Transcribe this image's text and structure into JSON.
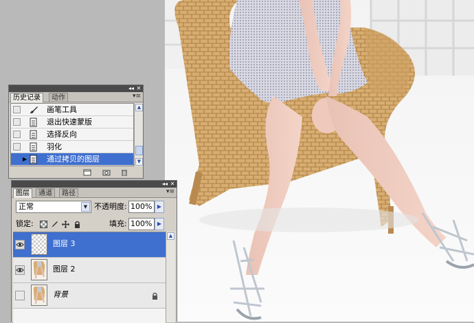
{
  "history_panel": {
    "tabs": [
      "历史记录",
      "动作"
    ],
    "items": [
      {
        "label": "画笔工具",
        "icon": "brush-icon"
      },
      {
        "label": "退出快速蒙版",
        "icon": "history-state-icon"
      },
      {
        "label": "选择反向",
        "icon": "history-state-icon"
      },
      {
        "label": "羽化",
        "icon": "history-state-icon"
      },
      {
        "label": "通过拷贝的图层",
        "icon": "history-state-icon",
        "selected": true
      }
    ]
  },
  "layers_panel": {
    "tabs": [
      "图层",
      "通道",
      "路径"
    ],
    "blend_mode": "正常",
    "opacity_label": "不透明度:",
    "opacity_value": "100%",
    "lock_label": "锁定:",
    "fill_label": "填充:",
    "fill_value": "100%",
    "layers": [
      {
        "name": "图层 3",
        "visible": true,
        "selected": true
      },
      {
        "name": "图层 2",
        "visible": true,
        "selected": false
      },
      {
        "name": "背景",
        "visible": false,
        "selected": false,
        "locked": true
      }
    ]
  },
  "colors": {
    "selection": "#3f6fcf",
    "panel_bg": "#d4d0c8",
    "titlebar": "#4a4a4a"
  }
}
